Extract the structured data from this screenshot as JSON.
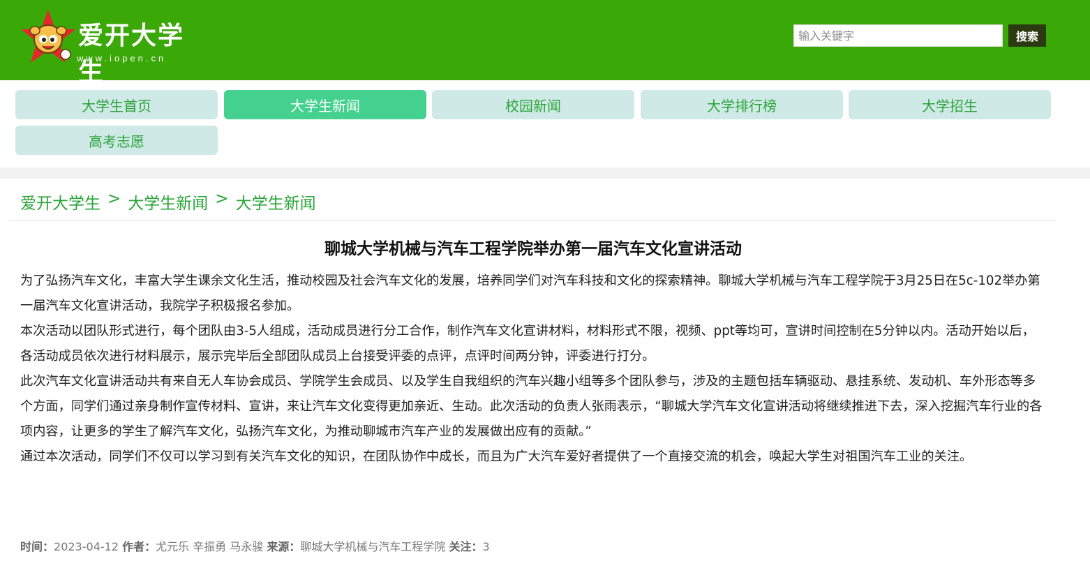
{
  "header": {
    "logo_title": "爱开大学生",
    "logo_url": "www.iopen.cn",
    "search_placeholder": "输入关键字",
    "search_button": "搜索"
  },
  "nav": {
    "items": [
      {
        "label": "大学生首页",
        "active": false
      },
      {
        "label": "大学生新闻",
        "active": true
      },
      {
        "label": "校园新闻",
        "active": false
      },
      {
        "label": "大学排行榜",
        "active": false
      },
      {
        "label": "大学招生",
        "active": false
      },
      {
        "label": "高考志愿",
        "active": false
      }
    ]
  },
  "breadcrumb": {
    "items": [
      "爱开大学生",
      "大学生新闻",
      "大学生新闻"
    ],
    "separator": ">"
  },
  "article": {
    "title": "聊城大学机械与汽车工程学院举办第一届汽车文化宣讲活动",
    "paragraphs": [
      "为了弘扬汽车文化，丰富大学生课余文化生活，推动校园及社会汽车文化的发展，培养同学们对汽车科技和文化的探索精神。聊城大学机械与汽车工程学院于3月25日在5c-102举办第一届汽车文化宣讲活动，我院学子积极报名参加。",
      "本次活动以团队形式进行，每个团队由3-5人组成，活动成员进行分工合作，制作汽车文化宣讲材料，材料形式不限，视频、ppt等均可，宣讲时间控制在5分钟以内。活动开始以后，各活动成员依次进行材料展示，展示完毕后全部团队成员上台接受评委的点评，点评时间两分钟，评委进行打分。",
      "此次汽车文化宣讲活动共有来自无人车协会成员、学院学生会成员、以及学生自我组织的汽车兴趣小组等多个团队参与，涉及的主题包括车辆驱动、悬挂系统、发动机、车外形态等多个方面，同学们通过亲身制作宣传材料、宣讲，来让汽车文化变得更加亲近、生动。此次活动的负责人张雨表示，“聊城大学汽车文化宣讲活动将继续推进下去，深入挖掘汽车行业的各项内容，让更多的学生了解汽车文化，弘扬汽车文化，为推动聊城市汽车产业的发展做出应有的贡献。”",
      "通过本次活动，同学们不仅可以学习到有关汽车文化的知识，在团队协作中成长，而且为广大汽车爱好者提供了一个直接交流的机会，唤起大学生对祖国汽车工业的关注。"
    ],
    "meta": {
      "time_label": "时间：",
      "time_value": "2023-04-12",
      "author_label": "作者：",
      "author_value": "尤元乐 辛振勇 马永骏",
      "source_label": "来源：",
      "source_value": "聊城大学机械与汽车工程学院",
      "follow_label": "关注：",
      "follow_value": "3"
    }
  },
  "colors": {
    "header_bg": "#3aa806",
    "nav_bg": "#cfe9e7",
    "nav_active_bg": "#44d18f",
    "accent_green": "#2aa438",
    "search_button_bg": "#2c3a12"
  },
  "icons": {
    "logo": "star-mascot-logo-icon"
  }
}
